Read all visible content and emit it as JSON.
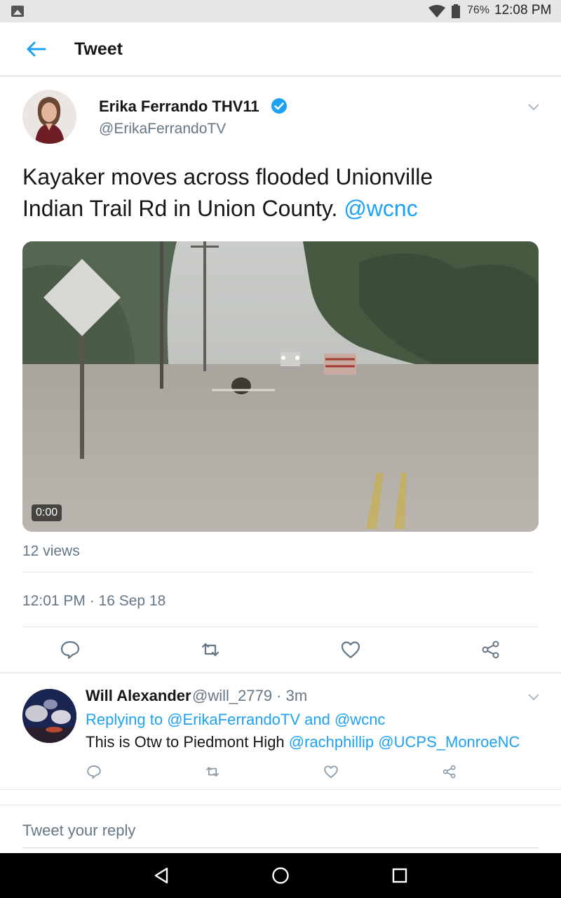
{
  "status_bar": {
    "battery": "76%",
    "time": "12:08 PM"
  },
  "header": {
    "title": "Tweet"
  },
  "tweet": {
    "author_name": "Erika Ferrando THV11",
    "author_handle": "@ErikaFerrandoTV",
    "text_line1": "Kayaker moves across flooded Unionville",
    "text_line2": "Indian Trail Rd in Union County. ",
    "text_mention": "@wcnc",
    "video_duration": "0:00",
    "views": "12 views",
    "timestamp": "12:01 PM · 16 Sep 18"
  },
  "reply": {
    "name": "Will Alexander",
    "handle_time": "@will_2779 · 3m",
    "replying_prefix": "Replying to ",
    "replying_user1": "@ErikaFerrandoTV",
    "replying_and": " and ",
    "replying_user2": "@wcnc",
    "text": "This is Otw to Piedmont High ",
    "mention1": "@rachphillip",
    "mention2": "@UCPS_MonroeNC"
  },
  "compose": {
    "placeholder": "Tweet your reply"
  },
  "colors": {
    "accent": "#1da1f2",
    "secondary_text": "#657786",
    "primary_text": "#14171a"
  }
}
